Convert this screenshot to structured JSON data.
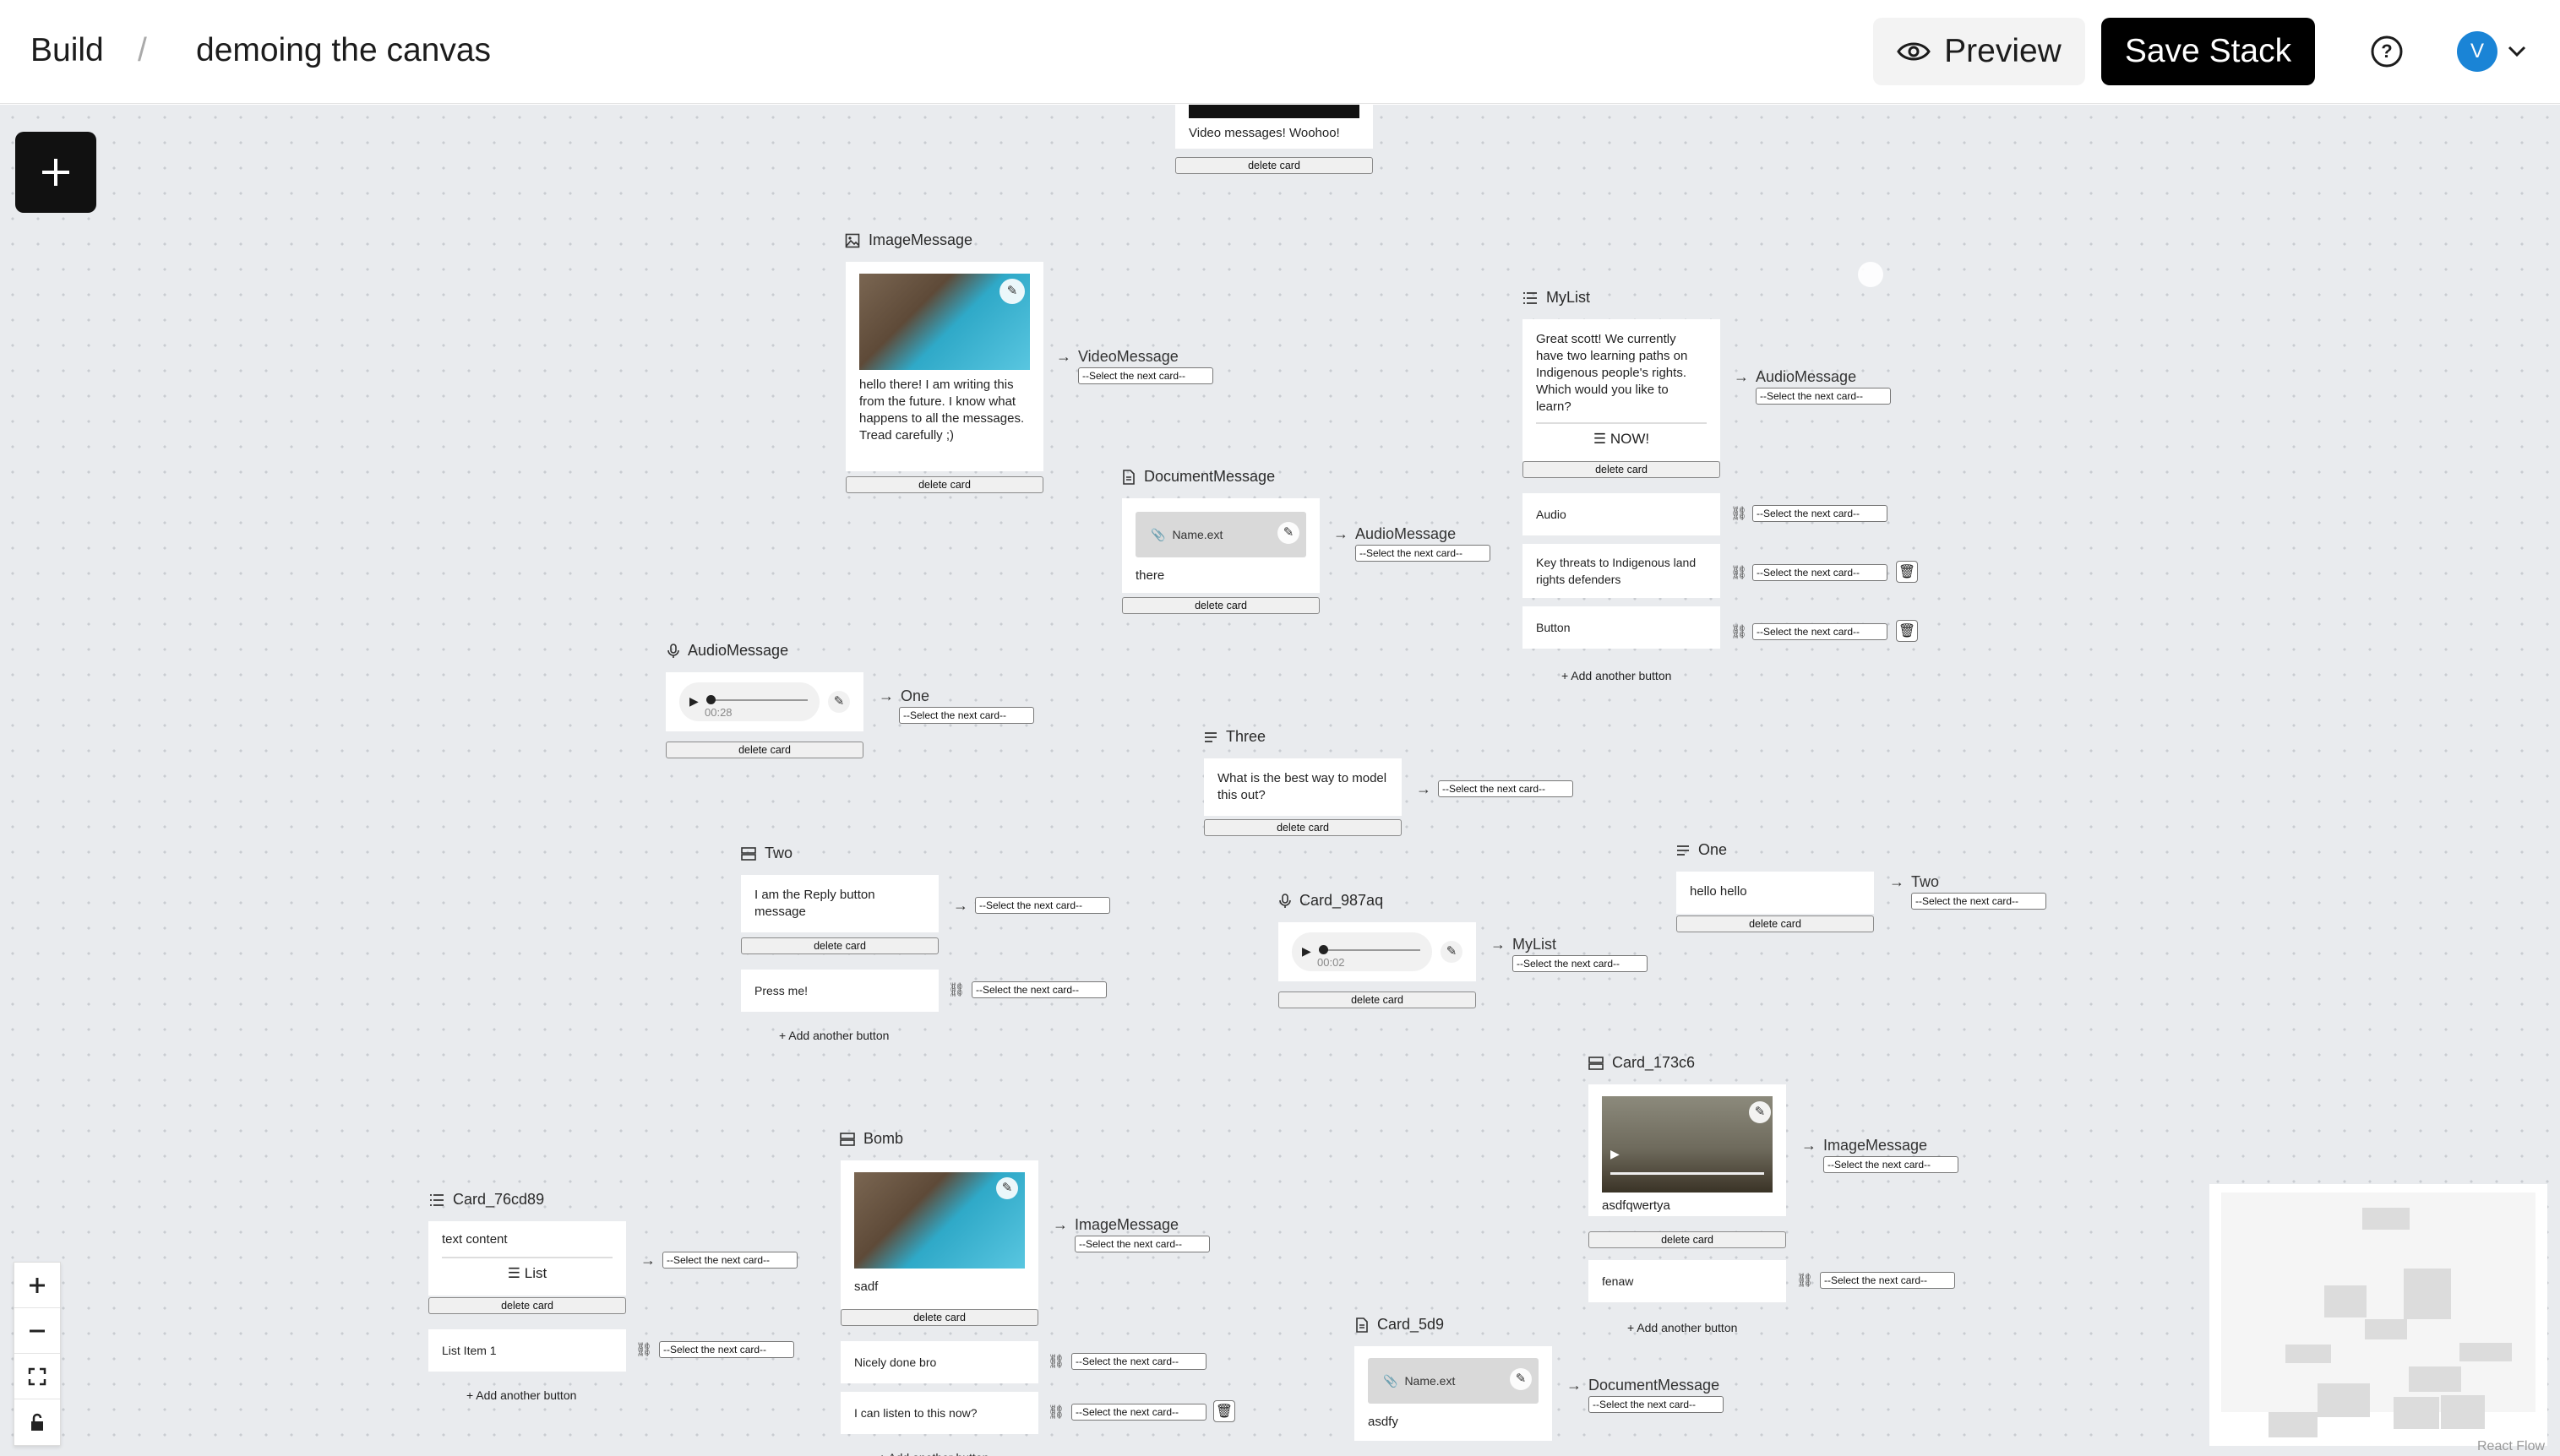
{
  "header": {
    "crumb_build": "Build",
    "crumb_sep": "/",
    "stack_name": "demoing the canvas",
    "preview_label": "Preview",
    "save_label": "Save Stack",
    "avatar_initial": "V"
  },
  "common": {
    "delete_card": "delete card",
    "select_next": "--Select the next card--",
    "add_button": "Add another button",
    "list_label": "List"
  },
  "cards": {
    "video_top": {
      "text": "Video messages! Woohoo!"
    },
    "image_message": {
      "title": "ImageMessage",
      "text": "hello there! I am writing this from the future. I know what happens to all the messages. Tread carefully ;)",
      "next": "VideoMessage"
    },
    "my_list": {
      "title": "MyList",
      "text": "Great scott! We currently have two learning paths on Indigenous people's rights. Which would you like to learn?",
      "list_button": "NOW!",
      "next": "AudioMessage",
      "options": [
        "Audio",
        "Key threats to Indigenous land rights defenders",
        "Button"
      ]
    },
    "document_message": {
      "title": "DocumentMessage",
      "file": "Name.ext",
      "text": "there",
      "next": "AudioMessage"
    },
    "audio_message": {
      "title": "AudioMessage",
      "time": "00:28",
      "next": "One"
    },
    "three": {
      "title": "Three",
      "text": "What is the best way to model this out?"
    },
    "two": {
      "title": "Two",
      "text": "I am the Reply button message",
      "option": "Press me!"
    },
    "card_987aq": {
      "title": "Card_987aq",
      "time": "00:02",
      "next": "MyList"
    },
    "one": {
      "title": "One",
      "text": "hello hello",
      "next": "Two"
    },
    "card_173c6": {
      "title": "Card_173c6",
      "text": "asdfqwertya",
      "next": "ImageMessage",
      "option": "fenaw"
    },
    "bomb": {
      "title": "Bomb",
      "text": "sadf",
      "next": "ImageMessage",
      "options": [
        "Nicely done bro",
        "I can listen to this now?"
      ]
    },
    "card_76cd89": {
      "title": "Card_76cd89",
      "text": "text content",
      "option": "List Item 1"
    },
    "card_5d9": {
      "title": "Card_5d9",
      "file": "Name.ext",
      "text": "asdfy",
      "next": "DocumentMessage"
    }
  },
  "attribution": "React Flow",
  "colors": {
    "accent": "#1a84d6",
    "save_bg": "#000000",
    "canvas_bg": "#e9ebee"
  }
}
